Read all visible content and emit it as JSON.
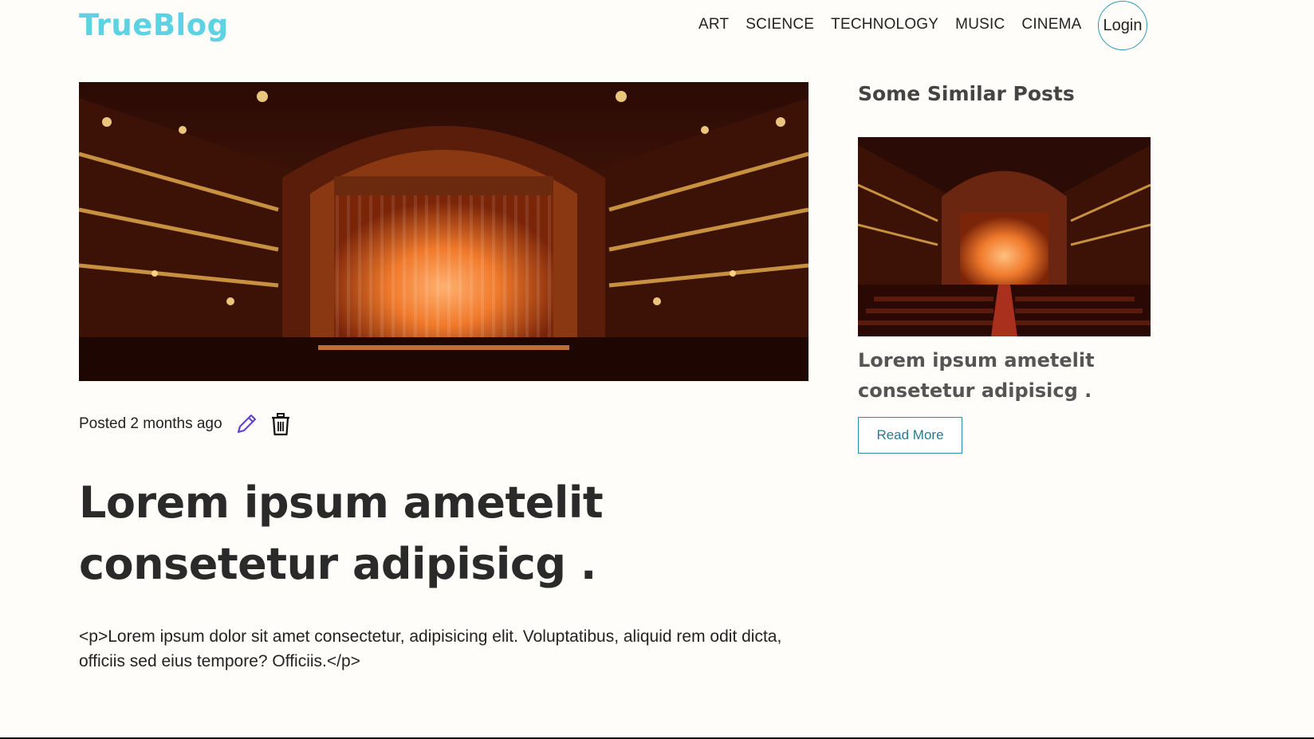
{
  "brand": {
    "name": "TrueBlog",
    "color": "#5cd2e3"
  },
  "nav": {
    "links": [
      "ART",
      "SCIENCE",
      "TECHNOLOGY",
      "MUSIC",
      "CINEMA"
    ],
    "login_label": "Login"
  },
  "post": {
    "meta": "Posted 2 months ago",
    "title": "Lorem ipsum ametelit consetetur adipisicg .",
    "body": "<p>Lorem ipsum dolor sit amet consectetur, adipisicing elit. Voluptatibus, aliquid rem odit dicta, officiis sed eius tempore? Officiis.</p>",
    "edit_icon": "pencil-icon",
    "delete_icon": "trash-icon"
  },
  "sidebar": {
    "heading": "Some Similar Posts",
    "cards": [
      {
        "title": "Lorem ipsum ametelit consetetur adipisicg .",
        "button_label": "Read More"
      }
    ]
  },
  "colors": {
    "accent": "#2a9cb4",
    "edit_icon": "#5b3fd6"
  }
}
